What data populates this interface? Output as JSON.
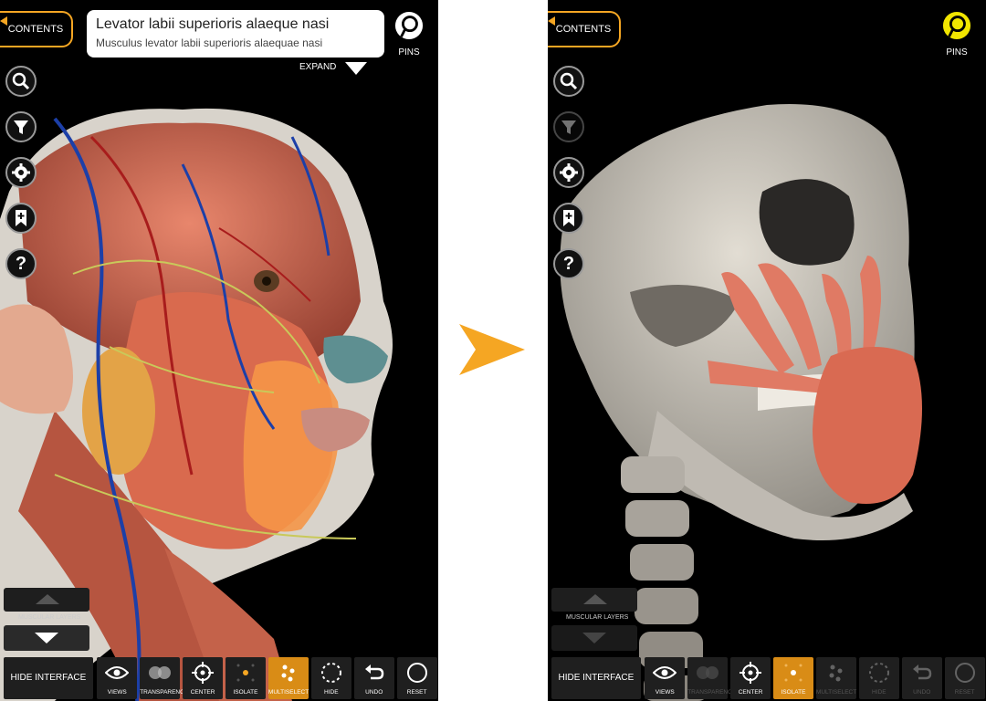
{
  "colors": {
    "accent": "#f5a623",
    "active_button": "#d98c16",
    "pins_active": "#f2e600",
    "muscle": "#d9705a",
    "bone": "#cfcac0"
  },
  "left": {
    "contents_label": "CONTENTS",
    "structure_name": "Levator labii superioris alaeque nasi",
    "structure_latin": "Musculus levator labii superioris alaequae nasi",
    "expand_label": "EXPAND",
    "pins_label": "PINS",
    "layers_label": "MUSCULAR LAYERS",
    "hide_interface": "HIDE INTERFACE",
    "tools": [
      "search-icon",
      "filter-icon",
      "gear-icon",
      "bookmark-add-icon",
      "help-icon"
    ],
    "toolbar": [
      {
        "label": "VIEWS",
        "icon": "eye-icon",
        "state": "normal"
      },
      {
        "label": "TRANSPARENCY",
        "icon": "transparency-icon",
        "state": "normal"
      },
      {
        "label": "CENTER",
        "icon": "crosshair-icon",
        "state": "normal"
      },
      {
        "label": "ISOLATE",
        "icon": "isolate-icon",
        "state": "normal"
      },
      {
        "label": "MULTISELECT",
        "icon": "multiselect-icon",
        "state": "active"
      },
      {
        "label": "HIDE",
        "icon": "dashed-circle-icon",
        "state": "normal"
      },
      {
        "label": "UNDO",
        "icon": "undo-icon",
        "state": "normal"
      },
      {
        "label": "RESET",
        "icon": "circle-icon",
        "state": "normal"
      }
    ]
  },
  "right": {
    "contents_label": "CONTENTS",
    "pins_label": "PINS",
    "layers_label": "MUSCULAR LAYERS",
    "hide_interface": "HIDE INTERFACE",
    "toolbar": [
      {
        "label": "VIEWS",
        "icon": "eye-icon",
        "state": "normal"
      },
      {
        "label": "TRANSPARENCY",
        "icon": "transparency-icon",
        "state": "disabled"
      },
      {
        "label": "CENTER",
        "icon": "crosshair-icon",
        "state": "normal"
      },
      {
        "label": "ISOLATE",
        "icon": "isolate-icon",
        "state": "active"
      },
      {
        "label": "MULTISELECT",
        "icon": "multiselect-icon",
        "state": "disabled"
      },
      {
        "label": "HIDE",
        "icon": "dashed-circle-icon",
        "state": "disabled"
      },
      {
        "label": "UNDO",
        "icon": "undo-icon",
        "state": "disabled"
      },
      {
        "label": "RESET",
        "icon": "circle-icon",
        "state": "disabled"
      }
    ]
  }
}
